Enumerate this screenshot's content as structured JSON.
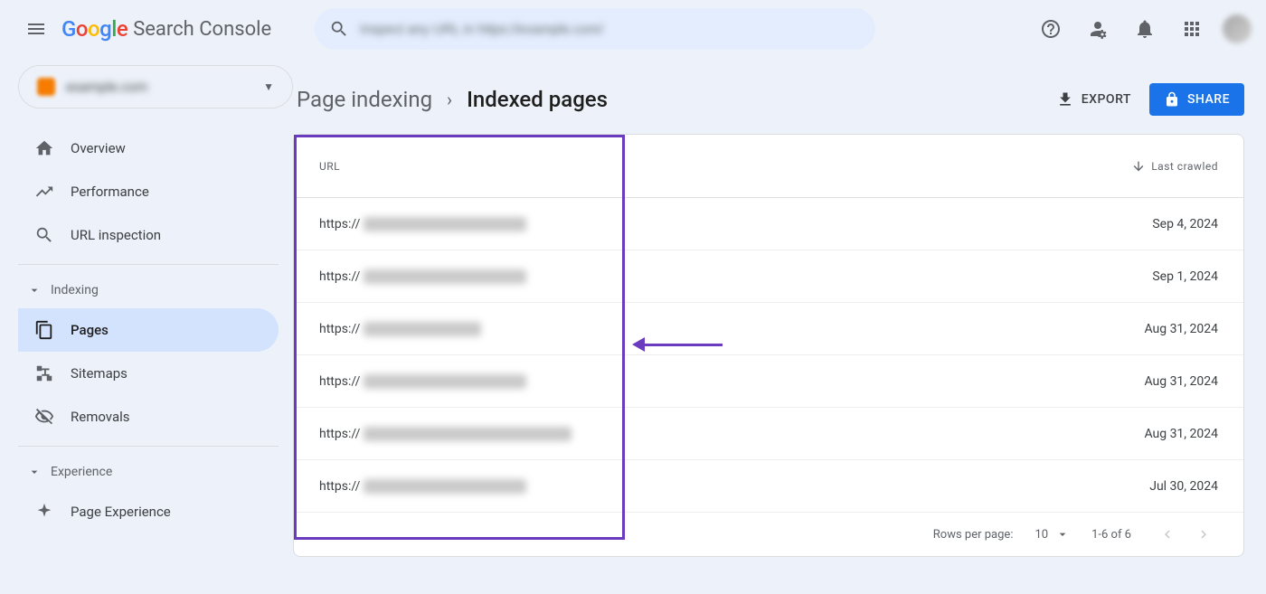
{
  "header": {
    "product": "Search Console",
    "search_placeholder": "Inspect any URL in https://example.com/"
  },
  "sidebar": {
    "property_label": "example.com",
    "items": {
      "overview": "Overview",
      "performance": "Performance",
      "url_inspection": "URL inspection",
      "pages": "Pages",
      "sitemaps": "Sitemaps",
      "removals": "Removals",
      "page_experience": "Page Experience"
    },
    "groups": {
      "indexing": "Indexing",
      "experience": "Experience"
    }
  },
  "breadcrumb": {
    "parent": "Page indexing",
    "current": "Indexed pages"
  },
  "actions": {
    "export": "EXPORT",
    "share": "SHARE"
  },
  "table": {
    "header_url": "URL",
    "header_crawled": "Last crawled",
    "url_prefix": "https://",
    "rows": [
      {
        "date": "Sep 4, 2024"
      },
      {
        "date": "Sep 1, 2024"
      },
      {
        "date": "Aug 31, 2024"
      },
      {
        "date": "Aug 31, 2024"
      },
      {
        "date": "Aug 31, 2024"
      },
      {
        "date": "Jul 30, 2024"
      }
    ],
    "footer": {
      "rpp_label": "Rows per page:",
      "rpp_value": "10",
      "range": "1-6 of 6"
    }
  }
}
